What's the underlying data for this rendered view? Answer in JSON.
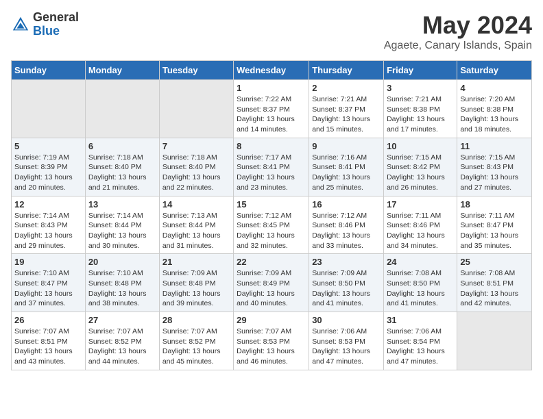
{
  "header": {
    "logo_general": "General",
    "logo_blue": "Blue",
    "month_title": "May 2024",
    "subtitle": "Agaete, Canary Islands, Spain"
  },
  "days_of_week": [
    "Sunday",
    "Monday",
    "Tuesday",
    "Wednesday",
    "Thursday",
    "Friday",
    "Saturday"
  ],
  "weeks": [
    [
      {
        "day": "",
        "info": ""
      },
      {
        "day": "",
        "info": ""
      },
      {
        "day": "",
        "info": ""
      },
      {
        "day": "1",
        "info": "Sunrise: 7:22 AM\nSunset: 8:37 PM\nDaylight: 13 hours and 14 minutes."
      },
      {
        "day": "2",
        "info": "Sunrise: 7:21 AM\nSunset: 8:37 PM\nDaylight: 13 hours and 15 minutes."
      },
      {
        "day": "3",
        "info": "Sunrise: 7:21 AM\nSunset: 8:38 PM\nDaylight: 13 hours and 17 minutes."
      },
      {
        "day": "4",
        "info": "Sunrise: 7:20 AM\nSunset: 8:38 PM\nDaylight: 13 hours and 18 minutes."
      }
    ],
    [
      {
        "day": "5",
        "info": "Sunrise: 7:19 AM\nSunset: 8:39 PM\nDaylight: 13 hours and 20 minutes."
      },
      {
        "day": "6",
        "info": "Sunrise: 7:18 AM\nSunset: 8:40 PM\nDaylight: 13 hours and 21 minutes."
      },
      {
        "day": "7",
        "info": "Sunrise: 7:18 AM\nSunset: 8:40 PM\nDaylight: 13 hours and 22 minutes."
      },
      {
        "day": "8",
        "info": "Sunrise: 7:17 AM\nSunset: 8:41 PM\nDaylight: 13 hours and 23 minutes."
      },
      {
        "day": "9",
        "info": "Sunrise: 7:16 AM\nSunset: 8:41 PM\nDaylight: 13 hours and 25 minutes."
      },
      {
        "day": "10",
        "info": "Sunrise: 7:15 AM\nSunset: 8:42 PM\nDaylight: 13 hours and 26 minutes."
      },
      {
        "day": "11",
        "info": "Sunrise: 7:15 AM\nSunset: 8:43 PM\nDaylight: 13 hours and 27 minutes."
      }
    ],
    [
      {
        "day": "12",
        "info": "Sunrise: 7:14 AM\nSunset: 8:43 PM\nDaylight: 13 hours and 29 minutes."
      },
      {
        "day": "13",
        "info": "Sunrise: 7:14 AM\nSunset: 8:44 PM\nDaylight: 13 hours and 30 minutes."
      },
      {
        "day": "14",
        "info": "Sunrise: 7:13 AM\nSunset: 8:44 PM\nDaylight: 13 hours and 31 minutes."
      },
      {
        "day": "15",
        "info": "Sunrise: 7:12 AM\nSunset: 8:45 PM\nDaylight: 13 hours and 32 minutes."
      },
      {
        "day": "16",
        "info": "Sunrise: 7:12 AM\nSunset: 8:46 PM\nDaylight: 13 hours and 33 minutes."
      },
      {
        "day": "17",
        "info": "Sunrise: 7:11 AM\nSunset: 8:46 PM\nDaylight: 13 hours and 34 minutes."
      },
      {
        "day": "18",
        "info": "Sunrise: 7:11 AM\nSunset: 8:47 PM\nDaylight: 13 hours and 35 minutes."
      }
    ],
    [
      {
        "day": "19",
        "info": "Sunrise: 7:10 AM\nSunset: 8:47 PM\nDaylight: 13 hours and 37 minutes."
      },
      {
        "day": "20",
        "info": "Sunrise: 7:10 AM\nSunset: 8:48 PM\nDaylight: 13 hours and 38 minutes."
      },
      {
        "day": "21",
        "info": "Sunrise: 7:09 AM\nSunset: 8:48 PM\nDaylight: 13 hours and 39 minutes."
      },
      {
        "day": "22",
        "info": "Sunrise: 7:09 AM\nSunset: 8:49 PM\nDaylight: 13 hours and 40 minutes."
      },
      {
        "day": "23",
        "info": "Sunrise: 7:09 AM\nSunset: 8:50 PM\nDaylight: 13 hours and 41 minutes."
      },
      {
        "day": "24",
        "info": "Sunrise: 7:08 AM\nSunset: 8:50 PM\nDaylight: 13 hours and 41 minutes."
      },
      {
        "day": "25",
        "info": "Sunrise: 7:08 AM\nSunset: 8:51 PM\nDaylight: 13 hours and 42 minutes."
      }
    ],
    [
      {
        "day": "26",
        "info": "Sunrise: 7:07 AM\nSunset: 8:51 PM\nDaylight: 13 hours and 43 minutes."
      },
      {
        "day": "27",
        "info": "Sunrise: 7:07 AM\nSunset: 8:52 PM\nDaylight: 13 hours and 44 minutes."
      },
      {
        "day": "28",
        "info": "Sunrise: 7:07 AM\nSunset: 8:52 PM\nDaylight: 13 hours and 45 minutes."
      },
      {
        "day": "29",
        "info": "Sunrise: 7:07 AM\nSunset: 8:53 PM\nDaylight: 13 hours and 46 minutes."
      },
      {
        "day": "30",
        "info": "Sunrise: 7:06 AM\nSunset: 8:53 PM\nDaylight: 13 hours and 47 minutes."
      },
      {
        "day": "31",
        "info": "Sunrise: 7:06 AM\nSunset: 8:54 PM\nDaylight: 13 hours and 47 minutes."
      },
      {
        "day": "",
        "info": ""
      }
    ]
  ],
  "empty_cells_week0": [
    0,
    1,
    2
  ],
  "empty_cells_week4": [
    6
  ]
}
